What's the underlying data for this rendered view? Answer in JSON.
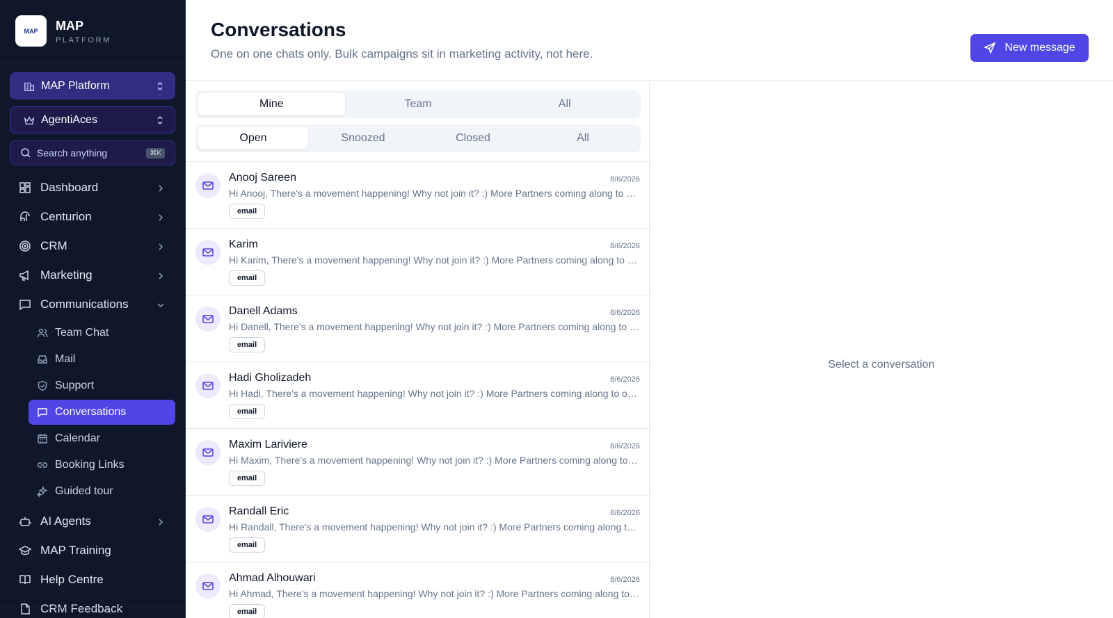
{
  "brand": {
    "name": "MAP",
    "sub": "PLATFORM",
    "logo_text": "MAP"
  },
  "selectors": {
    "platform": "MAP Platform",
    "workspace": "AgentiAces"
  },
  "search": {
    "placeholder": "Search anything",
    "shortcut": "⌘K"
  },
  "nav": {
    "dashboard": "Dashboard",
    "centurion": "Centurion",
    "crm": "CRM",
    "marketing": "Marketing",
    "communications": "Communications",
    "ai_agents": "AI Agents",
    "map_training": "MAP Training",
    "help_centre": "Help Centre",
    "crm_feedback": "CRM Feedback"
  },
  "subnav": {
    "team_chat": "Team Chat",
    "mail": "Mail",
    "support": "Support",
    "conversations": "Conversations",
    "calendar": "Calendar",
    "booking_links": "Booking Links",
    "guided_tour": "Guided tour"
  },
  "header": {
    "title": "Conversations",
    "subtitle": "One on one chats only. Bulk campaigns sit in marketing activity, not here.",
    "new_message": "New message"
  },
  "filters": {
    "scope": [
      "Mine",
      "Team",
      "All"
    ],
    "status": [
      "Open",
      "Snoozed",
      "Closed",
      "All"
    ]
  },
  "conversations": [
    {
      "name": "Anooj Sareen",
      "date": "8/6/2026",
      "preview": "Hi Anooj, There's a movement happening! Why not join it? :) More Partners coming along to make it even bigger.",
      "channel": "email"
    },
    {
      "name": "Karim",
      "date": "8/6/2026",
      "preview": "Hi Karim, There's a movement happening! Why not join it? :) More Partners coming along to make it even bigger.",
      "channel": "email"
    },
    {
      "name": "Danell Adams",
      "date": "8/6/2026",
      "preview": "Hi Danell, There's a movement happening! Why not join it? :) More Partners coming along to make it even bigger.",
      "channel": "email"
    },
    {
      "name": "Hadi Gholizadeh",
      "date": "8/6/2026",
      "preview": "Hi Hadi, There's a movement happening! Why not join it? :) More Partners coming along to one bigger family.",
      "channel": "email"
    },
    {
      "name": "Maxim Lariviere",
      "date": "8/6/2026",
      "preview": "Hi Maxim, There's a movement happening! Why not join it? :) More Partners coming along to make it even bigger.",
      "channel": "email"
    },
    {
      "name": "Randall Eric",
      "date": "8/6/2026",
      "preview": "Hi Randall, There's a movement happening! Why not join it? :) More Partners coming along to make it even bigger.",
      "channel": "email"
    },
    {
      "name": "Ahmad Alhouwari",
      "date": "8/6/2026",
      "preview": "Hi Ahmad, There's a movement happening! Why not join it? :) More Partners coming along to make it even bigger.",
      "channel": "email"
    }
  ],
  "detail": {
    "empty_text": "Select a conversation"
  }
}
